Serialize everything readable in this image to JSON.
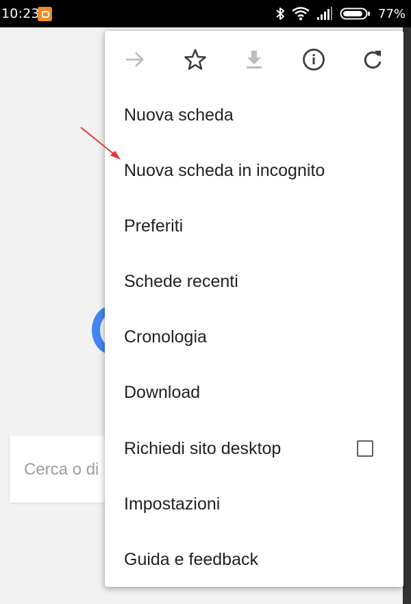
{
  "status_bar": {
    "time": "10:23",
    "battery_percent": "77%",
    "icons": [
      "app-notification-icon",
      "bluetooth-icon",
      "wifi-icon",
      "signal-icon",
      "battery-icon"
    ]
  },
  "page": {
    "search_placeholder": "Cerca o di"
  },
  "menu": {
    "toolbar": [
      {
        "name": "forward-icon",
        "enabled": false
      },
      {
        "name": "star-icon",
        "enabled": true
      },
      {
        "name": "download-icon",
        "enabled": false
      },
      {
        "name": "info-icon",
        "enabled": true
      },
      {
        "name": "reload-icon",
        "enabled": true
      }
    ],
    "items": [
      {
        "label": "Nuova scheda"
      },
      {
        "label": "Nuova scheda in incognito"
      },
      {
        "label": "Preferiti"
      },
      {
        "label": "Schede recenti"
      },
      {
        "label": "Cronologia"
      },
      {
        "label": "Download"
      },
      {
        "label": "Richiedi sito desktop",
        "checkbox": false
      },
      {
        "label": "Impostazioni"
      },
      {
        "label": "Guida e feedback"
      }
    ]
  },
  "colors": {
    "status_bar_bg": "#000000",
    "menu_bg": "#ffffff",
    "icon_active": "#3c3c3c",
    "icon_disabled": "#bdbdbd",
    "annotation_arrow": "#e53935",
    "google_blue": "#4285f4"
  }
}
